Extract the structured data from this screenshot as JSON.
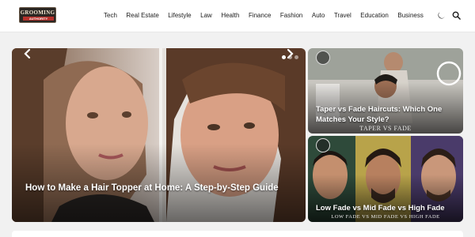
{
  "header": {
    "logo": {
      "top_text": "GROOMING",
      "bar_text": "AUTHORITY"
    },
    "nav": [
      "Tech",
      "Real Estate",
      "Lifestyle",
      "Law",
      "Health",
      "Finance",
      "Fashion",
      "Auto",
      "Travel",
      "Education",
      "Business"
    ],
    "icons": {
      "theme_toggle": "moon-icon",
      "search": "search-icon"
    }
  },
  "hero": {
    "title": "How to Make a Hair Topper at Home: A Step-by-Step Guide",
    "slides_total": 3,
    "active_slide": 1,
    "icons": {
      "prev": "chevron-left-icon",
      "next": "chevron-right-icon"
    }
  },
  "cards": [
    {
      "title": "Taper vs Fade Haircuts: Which One Matches Your Style?",
      "caption": "TAPER VS FADE"
    },
    {
      "title": "Low Fade vs Mid Fade vs High Fade",
      "caption": "LOW FADE VS MID FADE VS HIGH FADE"
    }
  ],
  "colors": {
    "header_bg": "#ffffff",
    "page_bg": "#f1f1f1",
    "title_text": "#ffffff",
    "logo_red": "#b5312b"
  }
}
